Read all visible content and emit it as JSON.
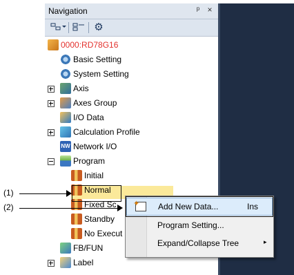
{
  "navigation": {
    "title": "Navigation",
    "pin_glyph": "ᵖ",
    "close_glyph": "×",
    "toolbar": {
      "view_icon": "tree-view-icon",
      "list_icon": "list-view-icon",
      "settings_icon": "gear-icon"
    }
  },
  "tree": {
    "project": "0000:RD78G16",
    "items": [
      {
        "label": "Basic Setting",
        "icon": "basic-setting-icon"
      },
      {
        "label": "System Setting",
        "icon": "system-setting-icon"
      },
      {
        "label": "Axis",
        "icon": "axis-icon"
      },
      {
        "label": "Axes Group",
        "icon": "axes-group-icon"
      },
      {
        "label": "I/O Data",
        "icon": "io-data-icon"
      },
      {
        "label": "Calculation Profile",
        "icon": "calculation-profile-icon"
      },
      {
        "label": "Network I/O",
        "icon": "network-io-icon"
      },
      {
        "label": "Program",
        "icon": "program-folder-icon"
      },
      {
        "label": "Initial",
        "icon": "program-icon"
      },
      {
        "label": "Normal",
        "icon": "program-icon"
      },
      {
        "label": "Fixed Sc",
        "icon": "program-icon"
      },
      {
        "label": "Standby",
        "icon": "program-icon"
      },
      {
        "label": "No Execut",
        "icon": "program-icon"
      },
      {
        "label": "FB/FUN",
        "icon": "fbfun-icon"
      },
      {
        "label": "Label",
        "icon": "label-icon"
      }
    ]
  },
  "context_menu": {
    "items": [
      {
        "label": "Add New Data...",
        "shortcut": "Ins"
      },
      {
        "label": "Program Setting...",
        "shortcut": ""
      },
      {
        "label": "Expand/Collapse Tree",
        "shortcut": "▸"
      }
    ]
  },
  "callouts": {
    "one": "(1)",
    "two": "(2)"
  },
  "colors": {
    "project_label": "#e3312d",
    "selection": "#fbe99a",
    "menu_hover": "#dcecfb",
    "pane_dark": "#1f2d44"
  }
}
